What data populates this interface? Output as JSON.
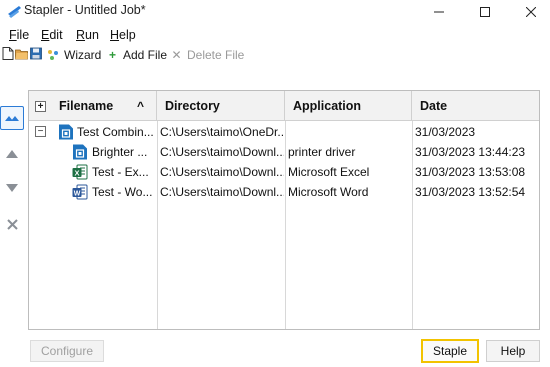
{
  "window": {
    "title": "Stapler - Untitled Job*",
    "icon": "stapler-icon",
    "controls": {
      "minimize": "–",
      "maximize": "☐",
      "close": "✕"
    }
  },
  "menu": {
    "items": [
      {
        "first": "F",
        "rest": "ile"
      },
      {
        "first": "E",
        "rest": "dit"
      },
      {
        "first": "R",
        "rest": "un"
      },
      {
        "first": "H",
        "rest": "elp"
      }
    ]
  },
  "toolbar": {
    "icons": [
      "new-document-icon",
      "open-folder-icon",
      "save-disk-icon"
    ],
    "wizard_label": "Wizard",
    "add_file_label": "Add File",
    "add_glyph": "+",
    "delete_file_label": "Delete File",
    "delete_glyph": "✕"
  },
  "side_buttons": [
    {
      "name": "move-top-button",
      "glyph": "▲",
      "active": true
    },
    {
      "name": "move-up-button",
      "glyph": "▲",
      "active": false
    },
    {
      "name": "move-down-button",
      "glyph": "▼",
      "active": false
    },
    {
      "name": "remove-button",
      "glyph": "✕",
      "active": false
    }
  ],
  "table": {
    "header_expander": "+",
    "columns": {
      "filename": "Filename",
      "filename_sort": "^",
      "directory": "Directory",
      "application": "Application",
      "date": "Date"
    },
    "rows": [
      {
        "expander": "−",
        "icon": "stapler-doc-icon",
        "icon_color": "#1e73be",
        "filename": "Test Combin...",
        "directory": "C:\\Users\\taimo\\OneDr...",
        "application": "",
        "date": "31/03/2023"
      },
      {
        "icon": "stapler-doc-icon",
        "icon_color": "#1e73be",
        "filename": "Brighter ...",
        "directory": "C:\\Users\\taimo\\Downl...",
        "application": "printer driver",
        "date": "31/03/2023 13:44:23"
      },
      {
        "icon": "excel-icon",
        "icon_color": "#1d7044",
        "icon_letter": "X",
        "filename": "Test - Ex...",
        "directory": "C:\\Users\\taimo\\Downl...",
        "application": "Microsoft Excel",
        "date": "31/03/2023 13:53:08"
      },
      {
        "icon": "word-icon",
        "icon_color": "#2b579a",
        "icon_letter": "W",
        "filename": "Test - Wo...",
        "directory": "C:\\Users\\taimo\\Downl...",
        "application": "Microsoft Word",
        "date": "31/03/2023 13:52:54"
      }
    ]
  },
  "footer": {
    "configure_label": "Configure",
    "staple_label": "Staple",
    "help_label": "Help"
  },
  "colors": {
    "accent_blue": "#2b7bd6",
    "focus_yellow": "#f2c300"
  }
}
